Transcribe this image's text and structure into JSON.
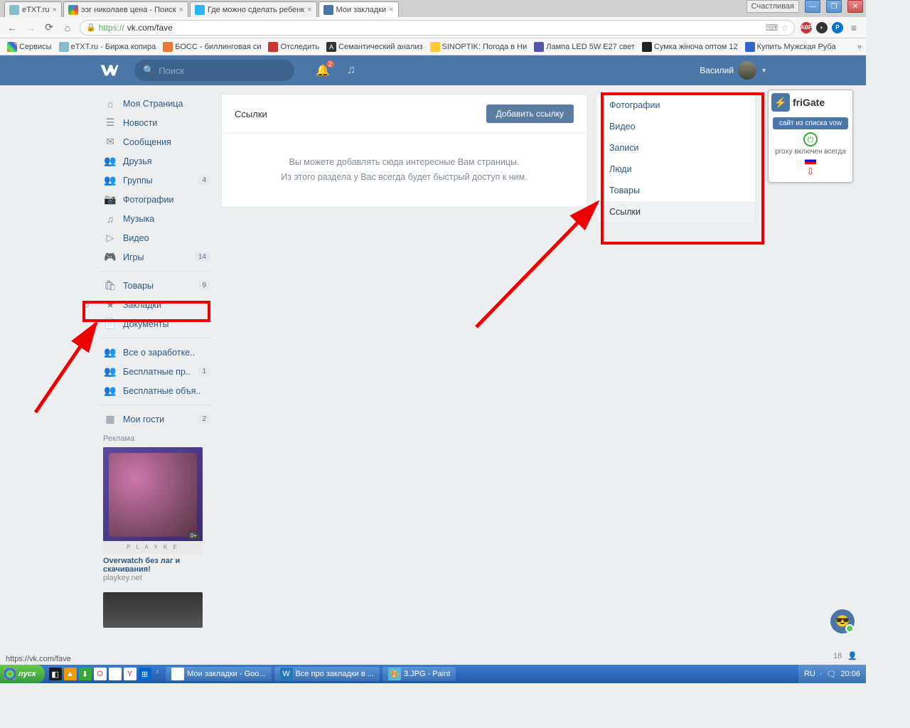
{
  "window": {
    "title_button": "Счастливая"
  },
  "tabs": [
    {
      "title": "eTXT.ru",
      "fav": "#8bc"
    },
    {
      "title": "ээг николаев цена - Поиск",
      "fav": "#4285f4"
    },
    {
      "title": "Где можно сделать ребенк",
      "fav": "#29b6f6"
    },
    {
      "title": "Мои закладки",
      "fav": "#4a76a8",
      "active": true
    }
  ],
  "url": {
    "proto": "https://",
    "host": "vk.com",
    "path": "/fave"
  },
  "bookmarks_bar": {
    "apps": "Сервисы",
    "items": [
      "eTXT.ru - Биржа копира",
      "БОСС - биллинговая си",
      "Отследить",
      "Семантический анализ",
      "SINOPTIK: Погода в Ни",
      "Лампа LED 5W E27 свет",
      "Сумка жіноча оптом 12",
      "Купить Мужская Руба"
    ]
  },
  "vk_header": {
    "search_placeholder": "Поиск",
    "bell_badge": "2",
    "username": "Василий"
  },
  "left_nav": {
    "items1": [
      {
        "icon": "⌂",
        "label": "Моя Страница"
      },
      {
        "icon": "☰",
        "label": "Новости"
      },
      {
        "icon": "✉",
        "label": "Сообщения"
      },
      {
        "icon": "👥",
        "label": "Друзья"
      },
      {
        "icon": "👥",
        "label": "Группы",
        "count": "4"
      },
      {
        "icon": "📷",
        "label": "Фотографии"
      },
      {
        "icon": "♫",
        "label": "Музыка"
      },
      {
        "icon": "▷",
        "label": "Видео"
      },
      {
        "icon": "🎮",
        "label": "Игры",
        "count": "14"
      }
    ],
    "items2": [
      {
        "icon": "🛍",
        "label": "Товары",
        "count": "9"
      },
      {
        "icon": "★",
        "label": "Закладки",
        "highlight": true
      },
      {
        "icon": "📄",
        "label": "Документы"
      }
    ],
    "items3": [
      {
        "icon": "👥",
        "label": "Все о заработке.."
      },
      {
        "icon": "👥",
        "label": "Бесплатные пр..",
        "count": "1"
      },
      {
        "icon": "👥",
        "label": "Бесплатные объя.."
      }
    ],
    "items4": [
      {
        "icon": "▦",
        "label": "Мои гости",
        "count": "2"
      }
    ],
    "ad_label": "Реклама",
    "ad": {
      "brand": "P L A Y K E",
      "title": "Overwatch без лаг и скачивания!",
      "domain": "playkey.net"
    }
  },
  "main_panel": {
    "title": "Ссылки",
    "button": "Добавить ссылку",
    "empty_line1": "Вы можете добавлять сюда интересные Вам страницы.",
    "empty_line2": "Из этого раздела у Вас всегда будет быстрый доступ к ним."
  },
  "right_tabs": [
    "Фотографии",
    "Видео",
    "Записи",
    "Люди",
    "Товары",
    "Ссылки"
  ],
  "right_active": "Ссылки",
  "frigate": {
    "name": "friGate",
    "btn": "сайт из списка vow",
    "proxy": "proxy включен всегда"
  },
  "status": {
    "url": "https://vk.com/fave",
    "count": "18"
  },
  "taskbar": {
    "start": "пуск",
    "tasks": [
      "Мои закладки - Goo...",
      "Все про закладки в ...",
      "3.JPG - Paint"
    ],
    "lang": "RU",
    "time": "20:06"
  }
}
